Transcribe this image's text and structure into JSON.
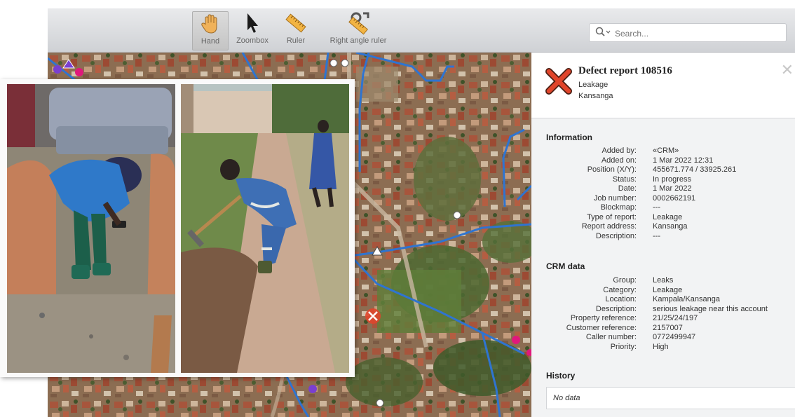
{
  "toolbar": {
    "tools": [
      {
        "label": "Hand",
        "icon": "hand-icon",
        "active": true
      },
      {
        "label": "Zoombox",
        "icon": "cursor-arrow-icon"
      },
      {
        "label": "Ruler",
        "icon": "ruler-icon"
      },
      {
        "label": "Right angle ruler",
        "icon": "right-angle-ruler-icon"
      }
    ],
    "search_placeholder": "Search..."
  },
  "defect_report": {
    "title": "Defect report 108516",
    "type": "Leakage",
    "area": "Kansanga",
    "icon": "defect-x-icon",
    "accent_color": "#d9452b"
  },
  "information": {
    "heading": "Information",
    "rows": [
      {
        "label": "Added by:",
        "value": "«CRM»"
      },
      {
        "label": "Added on:",
        "value": "1 Mar 2022 12:31"
      },
      {
        "label": "Position (X/Y):",
        "value": "455671.774 / 33925.261"
      },
      {
        "label": "Status:",
        "value": "In progress"
      },
      {
        "label": "Date:",
        "value": "1 Mar 2022"
      },
      {
        "label": "Job number:",
        "value": "0002662191"
      },
      {
        "label": "Blockmap:",
        "value": "---"
      },
      {
        "label": "Type of report:",
        "value": "Leakage"
      },
      {
        "label": "Report address:",
        "value": "Kansanga"
      },
      {
        "label": "Description:",
        "value": "---"
      }
    ]
  },
  "crm_data": {
    "heading": "CRM data",
    "rows": [
      {
        "label": "Group:",
        "value": "Leaks"
      },
      {
        "label": "Category:",
        "value": "Leakage"
      },
      {
        "label": "Location:",
        "value": "Kampala/Kansanga"
      },
      {
        "label": "Description:",
        "value": "serious leakage near this account"
      },
      {
        "label": "Property reference:",
        "value": "21/25/24/197"
      },
      {
        "label": "Customer reference:",
        "value": "2157007"
      },
      {
        "label": "Caller number:",
        "value": "0772499947"
      },
      {
        "label": "Priority:",
        "value": "High"
      }
    ]
  },
  "history": {
    "heading": "History",
    "empty_text": "No data"
  },
  "colors": {
    "pipe_line": "#2f74d0",
    "marker_pink": "#e0187c",
    "defect_marker": "#e0452b"
  }
}
